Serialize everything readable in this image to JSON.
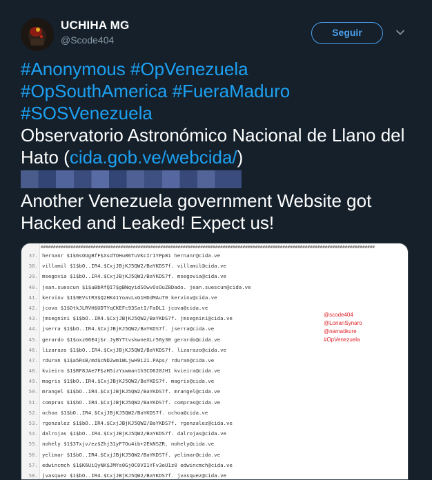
{
  "header": {
    "display_name": "UCHIHA MG",
    "handle": "@Scode404",
    "follow_label": "Seguir"
  },
  "tweet": {
    "hashtags_line1": [
      "#Anonymous",
      "#OpVenezuela"
    ],
    "hashtags_line2": [
      "#OpSouthAmerica",
      "#FueraMaduro"
    ],
    "hashtags_line3": [
      "#SOSVenezuela"
    ],
    "text_before_link": "Observatorio Astronómico Nacional de Llano del Hato (",
    "link": "cida.gob.ve/webcida/",
    "text_after_link": ")",
    "closing": "Another Venezuela government Website got Hacked and Leaked! Expect us!"
  },
  "media": {
    "hash_header": "######################################################################################################################################",
    "credits": [
      "@scode404",
      "@LorianSynaro",
      "@namatikure",
      "#OpVenezuela"
    ],
    "rows": [
      {
        "n": "37.",
        "code": "hernanr $1$6sOUgBfF$XsdTOHu86TuVKcIr1YPp81  hernanr@cida.ve"
      },
      {
        "n": "38.",
        "code": "villamil    $1$bO..IR4.$CxjJBjKJ5QW2/BaYKDS7f.  villamil@cida.ve"
      },
      {
        "n": "39.",
        "code": "msegovia    $1$bO..IR4.$CxjJBjKJ5QW2/BaYKDS7f.  msegovia@cida.ve"
      },
      {
        "n": "40.",
        "code": "jean.suescun    $1$uBbRfQI7$gBNqyidSOwvOsOuZ8Dado.  jean.suescun@cida.ve"
      },
      {
        "n": "41.",
        "code": "kervinv $1$9EVstR3$Q2HK41YoavLxG1HDdMAuT0  kervinv@cida.ve"
      },
      {
        "n": "42.",
        "code": "jcova   $1$OtkJLRVH$UDTYqCKEFc93SatI/FaDL1  jcova@cida.ve"
      },
      {
        "n": "43.",
        "code": "jmsegnini   $1$bO..IR4.$CxjJBjKJ5QW2/BaYKDS7f.  jmsegnini@cida.ve"
      },
      {
        "n": "44.",
        "code": "jserra  $1$bO..IR4.$CxjJBjKJ5QW2/BaYKDS7f.  jserra@cida.ve"
      },
      {
        "n": "45.",
        "code": "gerardo $1$oxz66E4j$r.JyBYTtvskwneXLr56y30  gerardo@cida.ve"
      },
      {
        "n": "46.",
        "code": "lizarazo    $1$bO..IR4.$CxjJBjKJ5QW2/BaYKDS7f.  lizarazo@cida.ve"
      },
      {
        "n": "47.",
        "code": "rduran  $1$a5RsB/md$cND2wm1WLjwH9i21.PAps/  rduran@cida.ve"
      },
      {
        "n": "48.",
        "code": "kvieira $1$RF8JAe7F$zH5izYxwman1h3CD620JH1  kvieira@cida.ve"
      },
      {
        "n": "49.",
        "code": "magris  $1$bO..IR4.$CxjJBjKJ5QW2/BaYKDS7f.  magris@cida.ve"
      },
      {
        "n": "50.",
        "code": "mrangel $1$bO..IR4.$CxjJBjKJ5QW2/BaYKDS7f.  mrangel@cida.ve"
      },
      {
        "n": "51.",
        "code": "compras $1$bO..IR4.$CxjJBjKJ5QW2/BaYKDS7f.  compras@cida.ve"
      },
      {
        "n": "52.",
        "code": "ochoa   $1$bO..IR4.$CxjJBjKJ5QW2/BaYKDS7f.  ochoa@cida.ve"
      },
      {
        "n": "53.",
        "code": "rgonzalez   $1$bO..IR4.$CxjJBjKJ5QW2/BaYKDS7f.  rgonzalez@cida.ve"
      },
      {
        "n": "54.",
        "code": "dalrojas    $1$bO..IR4.$CxjJBjKJ5QW2/BaYKDS7f.  dalrojas@cida.ve"
      },
      {
        "n": "55.",
        "code": "nohely  $1$3Txjv/ez$Zhj31yF7Ou4ib+2EkNSZR.  nohely@cida.ve"
      },
      {
        "n": "56.",
        "code": "yelimar $1$bO..IR4.$CxjJBjKJ5QW2/BaYKDS7f.  yelimar@cida.ve"
      },
      {
        "n": "57.",
        "code": "edwincmch   $1$K6UiQyNK$JMYs0GjOC0VI1YFv3eU1z0  edwincmch@cida.ve"
      },
      {
        "n": "58.",
        "code": "jvasquez    $1$bO..IR4.$CxjJBjKJ5QW2/BaYKDS7f.  jvasquez@cida.ve"
      }
    ]
  }
}
